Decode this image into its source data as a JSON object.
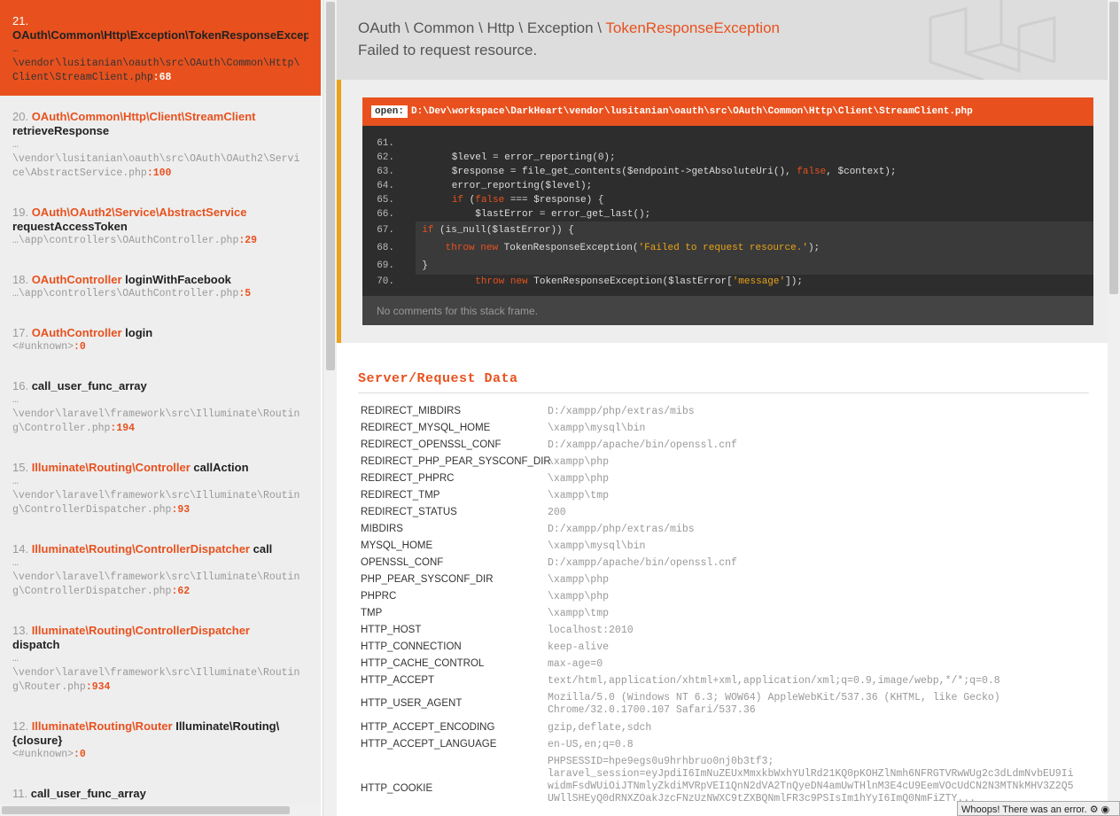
{
  "frames": [
    {
      "num": "21.",
      "cls": "OAuth\\Common\\Http\\Exception\\TokenResponseException",
      "meth": "",
      "path": "…\n\\vendor\\lusitanian\\oauth\\src\\OAuth\\Common\\Http\\\nClient\\StreamClient.php",
      "ln": ":68"
    },
    {
      "num": "20.",
      "cls": "OAuth\\Common\\Http\\Client\\StreamClient",
      "meth": "retrieveResponse",
      "path": "…\n\\vendor\\lusitanian\\oauth\\src\\OAuth\\OAuth2\\Servi\nce\\AbstractService.php",
      "ln": ":100"
    },
    {
      "num": "19.",
      "cls": "OAuth\\OAuth2\\Service\\AbstractService",
      "meth": "requestAccessToken",
      "path": "…\\app\\controllers\\OAuthController.php",
      "ln": ":29"
    },
    {
      "num": "18.",
      "cls": "OAuthController",
      "meth": "loginWithFacebook",
      "path": "…\\app\\controllers\\OAuthController.php",
      "ln": ":5"
    },
    {
      "num": "17.",
      "cls": "OAuthController",
      "meth": "login",
      "path": "<#unknown>",
      "ln": ":0"
    },
    {
      "num": "16.",
      "cls": "",
      "meth": "call_user_func_array",
      "path": "…\n\\vendor\\laravel\\framework\\src\\Illuminate\\Routin\ng\\Controller.php",
      "ln": ":194"
    },
    {
      "num": "15.",
      "cls": "Illuminate\\Routing\\Controller",
      "meth": "callAction",
      "path": "…\n\\vendor\\laravel\\framework\\src\\Illuminate\\Routin\ng\\ControllerDispatcher.php",
      "ln": ":93"
    },
    {
      "num": "14.",
      "cls": "Illuminate\\Routing\\ControllerDispatcher",
      "meth": "call",
      "path": "…\n\\vendor\\laravel\\framework\\src\\Illuminate\\Routin\ng\\ControllerDispatcher.php",
      "ln": ":62"
    },
    {
      "num": "13.",
      "cls": "Illuminate\\Routing\\ControllerDispatcher",
      "meth": "dispatch",
      "path": "…\n\\vendor\\laravel\\framework\\src\\Illuminate\\Routin\ng\\Router.php",
      "ln": ":934"
    },
    {
      "num": "12.",
      "cls": "Illuminate\\Routing\\Router",
      "meth": "Illuminate\\Routing\\{closure}",
      "path": "<#unknown>",
      "ln": ":0"
    },
    {
      "num": "11.",
      "cls": "",
      "meth": "call_user_func_array",
      "path": "",
      "ln": ""
    }
  ],
  "header": {
    "ns": [
      "OAuth",
      "Common",
      "Http",
      "Exception"
    ],
    "sep": " \\ ",
    "exc": "TokenResponseException",
    "message": "Failed to request resource."
  },
  "file": {
    "open_label": "open:",
    "path": "D:\\Dev\\workspace\\DarkHeart\\vendor\\lusitanian\\oauth\\src\\OAuth\\Common\\Http\\Client\\StreamClient.php"
  },
  "code": [
    {
      "n": "61.",
      "t": "",
      "hi": false
    },
    {
      "n": "62.",
      "t": "        $level = error_reporting(0);",
      "hi": false
    },
    {
      "n": "63.",
      "t": "        $response = file_get_contents($endpoint->getAbsoluteUri(), <k>false</k>, $context);",
      "hi": false
    },
    {
      "n": "64.",
      "t": "        error_reporting($level);",
      "hi": false
    },
    {
      "n": "65.",
      "t": "        <k>if</k> (<k>false</k> === $response) {",
      "hi": false
    },
    {
      "n": "66.",
      "t": "            $lastError = error_get_last();",
      "hi": false
    },
    {
      "n": "67.",
      "t": "            <k>if</k> (is_null($lastError)) {",
      "hi": true
    },
    {
      "n": "68.",
      "t": "                <k>throw</k> <k>new</k> TokenResponseException(<s>'Failed to request resource.'</s>);",
      "hi": true
    },
    {
      "n": "69.",
      "t": "            }",
      "hi": true
    },
    {
      "n": "70.",
      "t": "            <k>throw</k> <k>new</k> TokenResponseException($lastError[<s>'message'</s>]);",
      "hi": false
    }
  ],
  "comments": "No comments for this stack frame.",
  "section_title": "Server/Request Data",
  "rows": [
    {
      "k": "REDIRECT_MIBDIRS",
      "v": "D:/xampp/php/extras/mibs"
    },
    {
      "k": "REDIRECT_MYSQL_HOME",
      "v": "\\xampp\\mysql\\bin"
    },
    {
      "k": "REDIRECT_OPENSSL_CONF",
      "v": "D:/xampp/apache/bin/openssl.cnf"
    },
    {
      "k": "REDIRECT_PHP_PEAR_SYSCONF_DIR",
      "v": "\\xampp\\php"
    },
    {
      "k": "REDIRECT_PHPRC",
      "v": "\\xampp\\php"
    },
    {
      "k": "REDIRECT_TMP",
      "v": "\\xampp\\tmp"
    },
    {
      "k": "REDIRECT_STATUS",
      "v": "200"
    },
    {
      "k": "MIBDIRS",
      "v": "D:/xampp/php/extras/mibs"
    },
    {
      "k": "MYSQL_HOME",
      "v": "\\xampp\\mysql\\bin"
    },
    {
      "k": "OPENSSL_CONF",
      "v": "D:/xampp/apache/bin/openssl.cnf"
    },
    {
      "k": "PHP_PEAR_SYSCONF_DIR",
      "v": "\\xampp\\php"
    },
    {
      "k": "PHPRC",
      "v": "\\xampp\\php"
    },
    {
      "k": "TMP",
      "v": "\\xampp\\tmp"
    },
    {
      "k": "HTTP_HOST",
      "v": "localhost:2010"
    },
    {
      "k": "HTTP_CONNECTION",
      "v": "keep-alive"
    },
    {
      "k": "HTTP_CACHE_CONTROL",
      "v": "max-age=0"
    },
    {
      "k": "HTTP_ACCEPT",
      "v": "text/html,application/xhtml+xml,application/xml;q=0.9,image/webp,*/*;q=0.8"
    },
    {
      "k": "HTTP_USER_AGENT",
      "v": "Mozilla/5.0 (Windows NT 6.3; WOW64) AppleWebKit/537.36 (KHTML, like Gecko)\nChrome/32.0.1700.107 Safari/537.36"
    },
    {
      "k": "HTTP_ACCEPT_ENCODING",
      "v": "gzip,deflate,sdch"
    },
    {
      "k": "HTTP_ACCEPT_LANGUAGE",
      "v": "en-US,en;q=0.8"
    },
    {
      "k": "HTTP_COOKIE",
      "v": "PHPSESSID=hpe9egs0u9hrhbruo0nj0b3tf3;\nlaravel_session=eyJpdiI6ImNuZEUxMmxkbWxhYUlRd21KQ0pKOHZlNmh6NFRGTVRwWUg2c3dLdmNvbEU9Ii\nwidmFsdWUiOiJTNmlyZkdiMVRpVEI1QnN2dVA2TnQyeDN4amUwTHlnM3E4cU9EemVOcUdCN2N3MTNkMHV3Z2Q5\nUWllSHEyQ0dRNXZOakJzcFNzUzNWXC9tZXBQNmlFR3c9PSIsIm1hYyI6ImQ0NmFiZTY..."
    }
  ],
  "status": {
    "text": "Whoops! There was an error."
  }
}
